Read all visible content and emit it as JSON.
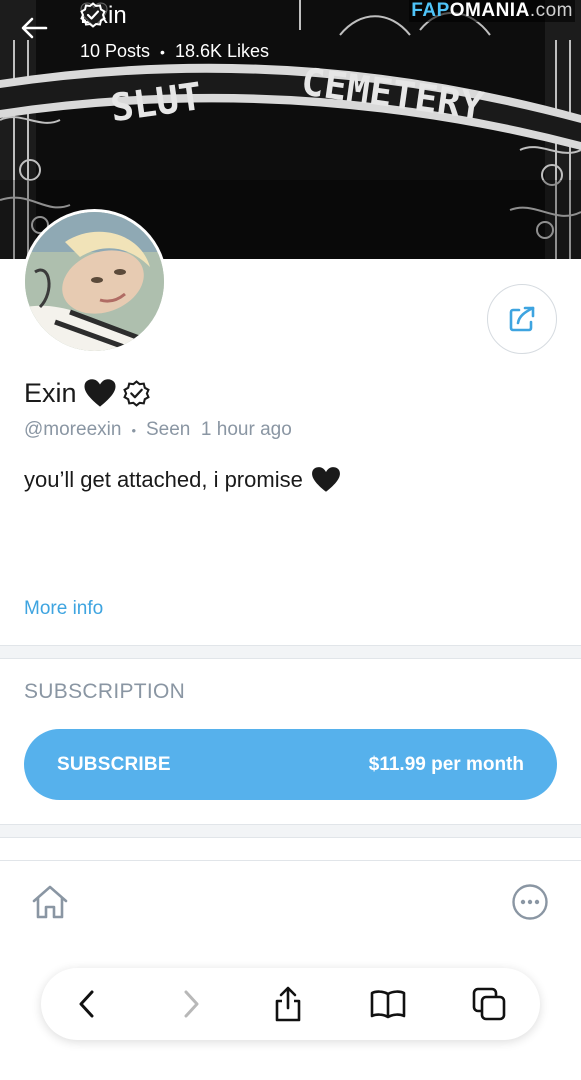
{
  "header": {
    "name": "Exin",
    "posts": "10 Posts",
    "separator": "•",
    "likes": "18.6K Likes"
  },
  "watermark": {
    "part1": "FAP",
    "part2": "OMANIA",
    "part3": ".com"
  },
  "cover": {
    "sign_left": "SLUT",
    "sign_right": "CEMETERY"
  },
  "profile": {
    "name": "Exin",
    "handle": "@moreexin",
    "separator": "•",
    "seen": "Seen  1 hour ago",
    "bio": "you’ll get attached, i promise",
    "more_info": "More info"
  },
  "subscription": {
    "heading": "SUBSCRIPTION",
    "button_label": "SUBSCRIBE",
    "price": "$11.99 per month"
  },
  "colors": {
    "accent": "#56b1ec",
    "link": "#3ea4e0",
    "muted": "#8a96a3"
  },
  "icons": {
    "back": "arrow-left-icon",
    "heart": "black-heart-icon",
    "verified": "verified-badge-icon",
    "share": "share-icon",
    "home": "home-icon",
    "more": "more-options-icon",
    "browser_back": "chevron-left-icon",
    "browser_forward": "chevron-right-icon",
    "browser_share": "share-upload-icon",
    "bookmarks": "book-icon",
    "tabs": "tabs-icon"
  }
}
